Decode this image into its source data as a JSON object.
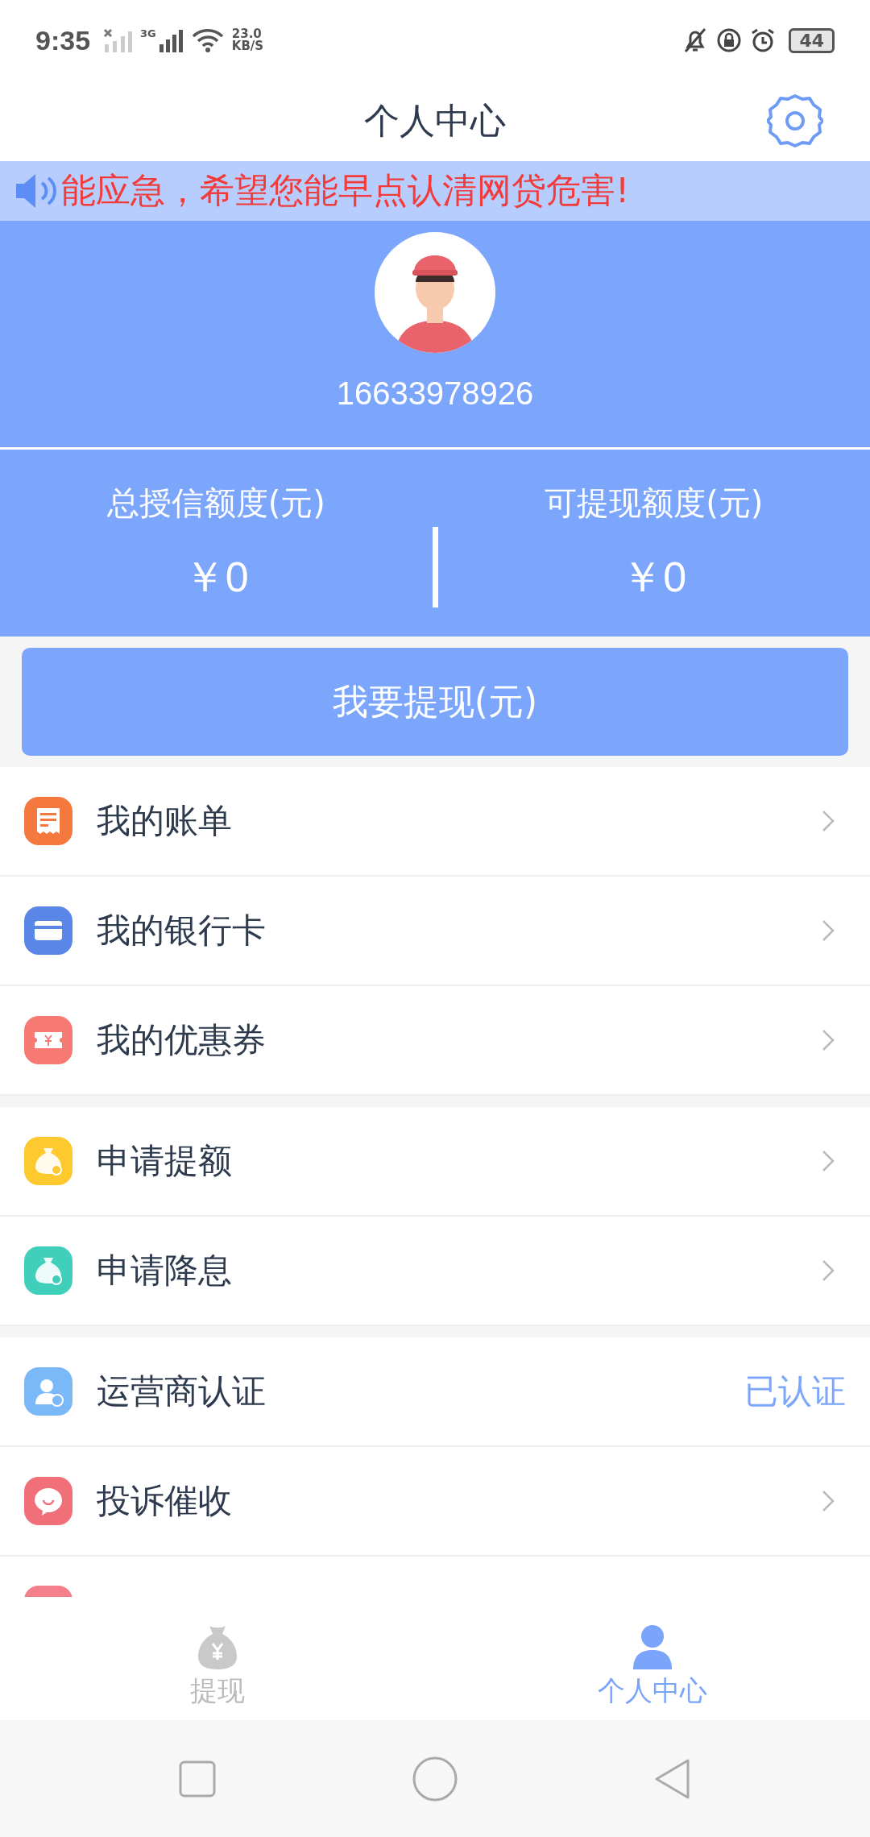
{
  "status_bar": {
    "time": "9:35",
    "network": "3G",
    "speed_value": "23.0",
    "speed_unit": "KB/S",
    "battery": "44"
  },
  "header": {
    "title": "个人中心"
  },
  "notice": {
    "text": "能应急，希望您能早点认清网贷危害!"
  },
  "profile": {
    "phone": "16633978926"
  },
  "stats": [
    {
      "label": "总授信额度(元)",
      "value": "￥0"
    },
    {
      "label": "可提现额度(元)",
      "value": "￥0"
    }
  ],
  "withdraw_button": {
    "label": "我要提现(元)"
  },
  "menu_sections": [
    {
      "items": [
        {
          "label": "我的账单",
          "color": "#f5793f",
          "kind": "chevron"
        },
        {
          "label": "我的银行卡",
          "color": "#5a86e8",
          "kind": "chevron"
        },
        {
          "label": "我的优惠券",
          "color": "#f67a72",
          "kind": "chevron"
        }
      ]
    },
    {
      "items": [
        {
          "label": "申请提额",
          "color": "#fdc92f",
          "kind": "chevron"
        },
        {
          "label": "申请降息",
          "color": "#3fcfbb",
          "kind": "chevron"
        }
      ]
    },
    {
      "items": [
        {
          "label": "运营商认证",
          "color": "#7ab8f8",
          "kind": "status",
          "status": "已认证"
        },
        {
          "label": "投诉催收",
          "color": "#f16f78",
          "kind": "chevron"
        },
        {
          "color": "#f3808a",
          "kind": "partial"
        }
      ]
    }
  ],
  "bottom_nav": [
    {
      "label": "提现",
      "selected": false
    },
    {
      "label": "个人中心",
      "selected": true
    }
  ]
}
